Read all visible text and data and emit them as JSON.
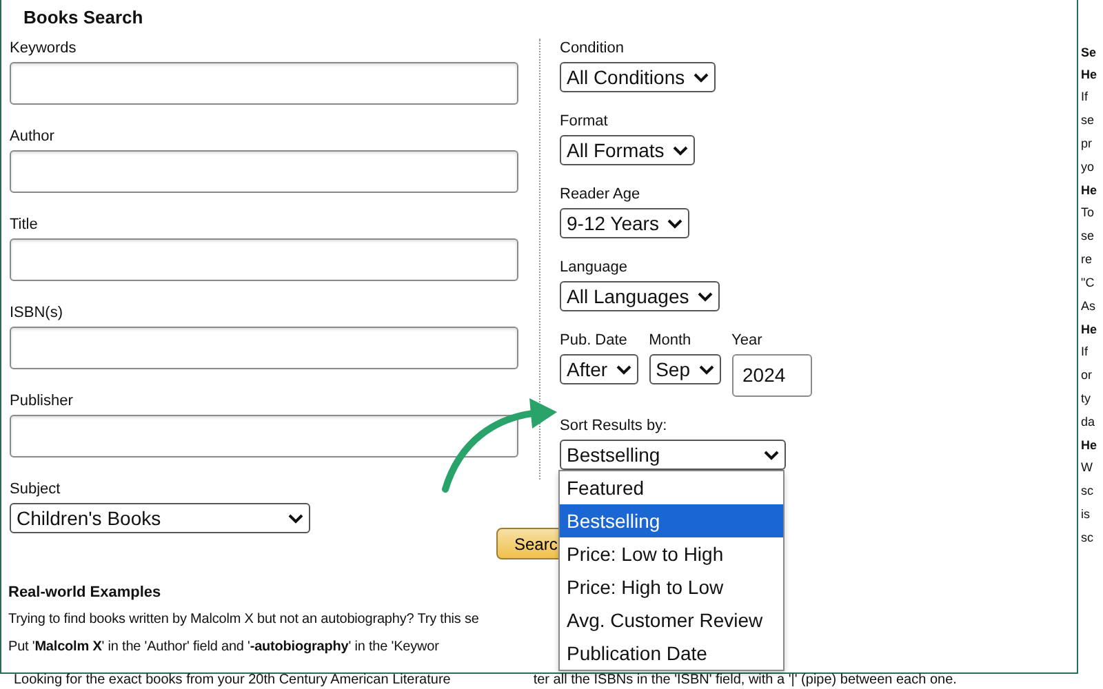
{
  "title": "Books Search",
  "left_fields": [
    {
      "label": "Keywords",
      "kind": "input"
    },
    {
      "label": "Author",
      "kind": "input"
    },
    {
      "label": "Title",
      "kind": "input"
    },
    {
      "label": "ISBN(s)",
      "kind": "input"
    },
    {
      "label": "Publisher",
      "kind": "input"
    },
    {
      "label": "Subject",
      "kind": "select",
      "value": "Children's Books"
    }
  ],
  "filter_rows": [
    [
      {
        "label": "Condition",
        "kind": "select",
        "value": "All Conditions"
      }
    ],
    [
      {
        "label": "Format",
        "kind": "select",
        "value": "All Formats"
      }
    ],
    [
      {
        "label": "Reader Age",
        "kind": "select",
        "value": "9-12 Years"
      }
    ],
    [
      {
        "label": "Language",
        "kind": "select",
        "value": "All Languages"
      }
    ],
    [
      {
        "label": "Pub. Date",
        "kind": "select",
        "value": "After"
      },
      {
        "label": "Month",
        "kind": "select",
        "value": "Sep"
      },
      {
        "label": "Year",
        "kind": "input",
        "value": "2024"
      }
    ]
  ],
  "sort": {
    "label": "Sort Results by:",
    "value": "Bestselling",
    "expanded": true,
    "options": [
      {
        "label": "Featured",
        "selected": false
      },
      {
        "label": "Bestselling",
        "selected": true
      },
      {
        "label": "Price: Low to High",
        "selected": false
      },
      {
        "label": "Price: High to Low",
        "selected": false
      },
      {
        "label": "Avg. Customer Review",
        "selected": false
      },
      {
        "label": "Publication Date",
        "selected": false
      }
    ]
  },
  "search_button": "Searc",
  "examples": {
    "heading": "Real-world Examples",
    "lines": [
      "Trying to find books written by Malcolm X but not an autobiography? Try this se",
      "Put '**Malcolm X**' in the 'Author' field and '**-autobiography**' in the 'Keywor"
    ]
  },
  "bottom_texts": [
    "Looking for the exact books from your 20th Century American Literature",
    "ter all the ISBNs in the 'ISBN' field, with a '|' (pipe) between each one."
  ],
  "side_panel": [
    {
      "kind": "heading",
      "text": "Se"
    },
    {
      "kind": "heading",
      "text": "He"
    },
    {
      "kind": "text",
      "text": "If"
    },
    {
      "kind": "text",
      "text": "se"
    },
    {
      "kind": "text",
      "text": "pr"
    },
    {
      "kind": "text",
      "text": "yo"
    },
    {
      "kind": "heading",
      "text": "He"
    },
    {
      "kind": "text",
      "text": "To"
    },
    {
      "kind": "text",
      "text": "se"
    },
    {
      "kind": "text",
      "text": "re"
    },
    {
      "kind": "text",
      "text": "\"C"
    },
    {
      "kind": "text",
      "text": "As"
    },
    {
      "kind": "heading",
      "text": "He"
    },
    {
      "kind": "text",
      "text": "If"
    },
    {
      "kind": "text",
      "text": "or"
    },
    {
      "kind": "text",
      "text": "ty"
    },
    {
      "kind": "text",
      "text": "da"
    },
    {
      "kind": "heading",
      "text": "He"
    },
    {
      "kind": "text",
      "text": "W"
    },
    {
      "kind": "text",
      "text": "sc"
    },
    {
      "kind": "text",
      "text": "is"
    },
    {
      "kind": "text",
      "text": "sc"
    }
  ]
}
